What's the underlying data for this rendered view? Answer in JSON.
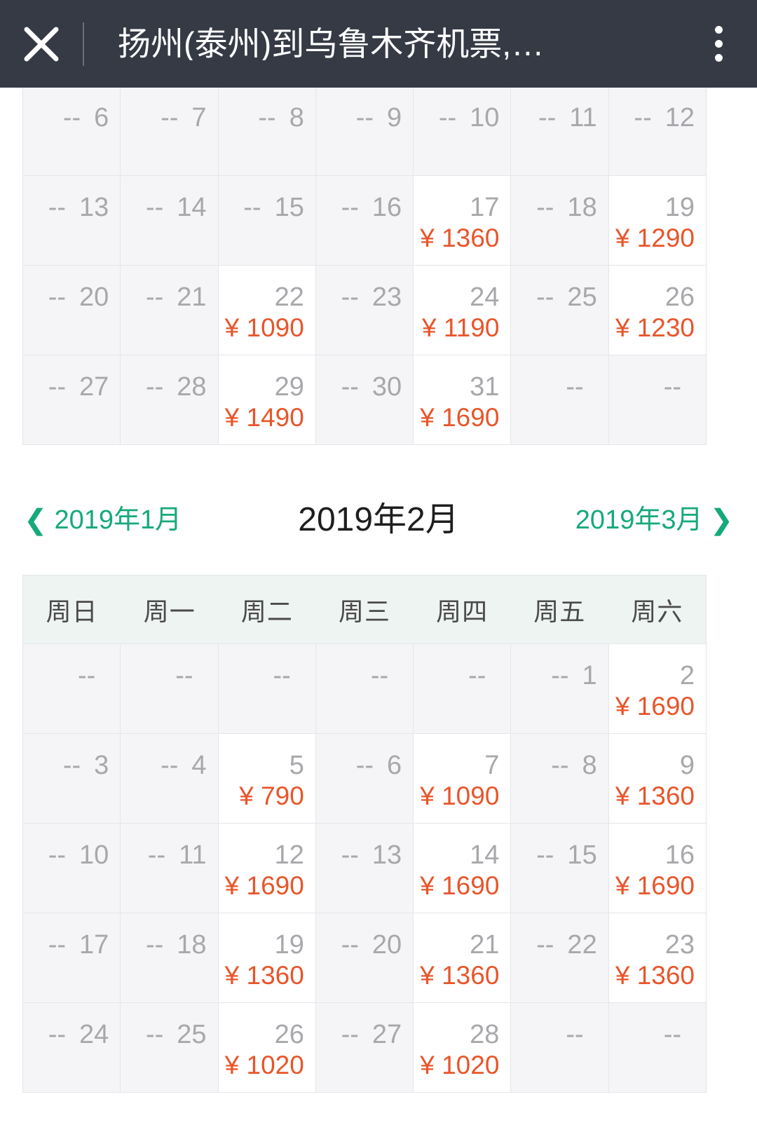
{
  "header": {
    "close_icon": "close-icon",
    "title": "扬州(泰州)到乌鲁木齐机票,…",
    "menu_icon": "more-vertical-icon",
    "background_color": "#353a45"
  },
  "colors": {
    "price": "#e8552a",
    "accent_green": "#16a97b",
    "disabled_cell": "#f5f5f7",
    "enabled_cell": "#ffffff",
    "weekday_header": "#eef4f2"
  },
  "weekdays": [
    "周日",
    "周一",
    "周二",
    "周三",
    "周四",
    "周五",
    "周六"
  ],
  "month_nav": {
    "prev_chevron": "chevron-left-icon",
    "prev_label": "2019年1月",
    "current_label": "2019年2月",
    "next_label": "2019年3月",
    "next_chevron": "chevron-right-icon"
  },
  "calendar_january": {
    "month_label": "2019年1月",
    "rows": [
      [
        {
          "day": "6",
          "dash": "--",
          "price": "",
          "enabled": false
        },
        {
          "day": "7",
          "dash": "--",
          "price": "",
          "enabled": false
        },
        {
          "day": "8",
          "dash": "--",
          "price": "",
          "enabled": false
        },
        {
          "day": "9",
          "dash": "--",
          "price": "",
          "enabled": false
        },
        {
          "day": "10",
          "dash": "--",
          "price": "",
          "enabled": false
        },
        {
          "day": "11",
          "dash": "--",
          "price": "",
          "enabled": false
        },
        {
          "day": "12",
          "dash": "--",
          "price": "",
          "enabled": false
        }
      ],
      [
        {
          "day": "13",
          "dash": "--",
          "price": "",
          "enabled": false
        },
        {
          "day": "14",
          "dash": "--",
          "price": "",
          "enabled": false
        },
        {
          "day": "15",
          "dash": "--",
          "price": "",
          "enabled": false
        },
        {
          "day": "16",
          "dash": "--",
          "price": "",
          "enabled": false
        },
        {
          "day": "17",
          "dash": "",
          "price": "¥ 1360",
          "enabled": true
        },
        {
          "day": "18",
          "dash": "--",
          "price": "",
          "enabled": false
        },
        {
          "day": "19",
          "dash": "",
          "price": "¥ 1290",
          "enabled": true
        }
      ],
      [
        {
          "day": "20",
          "dash": "--",
          "price": "",
          "enabled": false
        },
        {
          "day": "21",
          "dash": "--",
          "price": "",
          "enabled": false
        },
        {
          "day": "22",
          "dash": "",
          "price": "¥ 1090",
          "enabled": true
        },
        {
          "day": "23",
          "dash": "--",
          "price": "",
          "enabled": false
        },
        {
          "day": "24",
          "dash": "",
          "price": "¥ 1190",
          "enabled": true
        },
        {
          "day": "25",
          "dash": "--",
          "price": "",
          "enabled": false
        },
        {
          "day": "26",
          "dash": "",
          "price": "¥ 1230",
          "enabled": true
        }
      ],
      [
        {
          "day": "27",
          "dash": "--",
          "price": "",
          "enabled": false
        },
        {
          "day": "28",
          "dash": "--",
          "price": "",
          "enabled": false
        },
        {
          "day": "29",
          "dash": "",
          "price": "¥ 1490",
          "enabled": true
        },
        {
          "day": "30",
          "dash": "--",
          "price": "",
          "enabled": false
        },
        {
          "day": "31",
          "dash": "",
          "price": "¥ 1690",
          "enabled": true
        },
        {
          "day": "",
          "dash": "--",
          "price": "",
          "enabled": false
        },
        {
          "day": "",
          "dash": "--",
          "price": "",
          "enabled": false
        }
      ]
    ]
  },
  "calendar_february": {
    "month_label": "2019年2月",
    "rows": [
      [
        {
          "day": "",
          "dash": "--",
          "price": "",
          "enabled": false
        },
        {
          "day": "",
          "dash": "--",
          "price": "",
          "enabled": false
        },
        {
          "day": "",
          "dash": "--",
          "price": "",
          "enabled": false
        },
        {
          "day": "",
          "dash": "--",
          "price": "",
          "enabled": false
        },
        {
          "day": "",
          "dash": "--",
          "price": "",
          "enabled": false
        },
        {
          "day": "1",
          "dash": "--",
          "price": "",
          "enabled": false
        },
        {
          "day": "2",
          "dash": "",
          "price": "¥ 1690",
          "enabled": true
        }
      ],
      [
        {
          "day": "3",
          "dash": "--",
          "price": "",
          "enabled": false
        },
        {
          "day": "4",
          "dash": "--",
          "price": "",
          "enabled": false
        },
        {
          "day": "5",
          "dash": "",
          "price": "¥ 790",
          "enabled": true
        },
        {
          "day": "6",
          "dash": "--",
          "price": "",
          "enabled": false
        },
        {
          "day": "7",
          "dash": "",
          "price": "¥ 1090",
          "enabled": true
        },
        {
          "day": "8",
          "dash": "--",
          "price": "",
          "enabled": false
        },
        {
          "day": "9",
          "dash": "",
          "price": "¥ 1360",
          "enabled": true
        }
      ],
      [
        {
          "day": "10",
          "dash": "--",
          "price": "",
          "enabled": false
        },
        {
          "day": "11",
          "dash": "--",
          "price": "",
          "enabled": false
        },
        {
          "day": "12",
          "dash": "",
          "price": "¥ 1690",
          "enabled": true
        },
        {
          "day": "13",
          "dash": "--",
          "price": "",
          "enabled": false
        },
        {
          "day": "14",
          "dash": "",
          "price": "¥ 1690",
          "enabled": true
        },
        {
          "day": "15",
          "dash": "--",
          "price": "",
          "enabled": false
        },
        {
          "day": "16",
          "dash": "",
          "price": "¥ 1690",
          "enabled": true
        }
      ],
      [
        {
          "day": "17",
          "dash": "--",
          "price": "",
          "enabled": false
        },
        {
          "day": "18",
          "dash": "--",
          "price": "",
          "enabled": false
        },
        {
          "day": "19",
          "dash": "",
          "price": "¥ 1360",
          "enabled": true
        },
        {
          "day": "20",
          "dash": "--",
          "price": "",
          "enabled": false
        },
        {
          "day": "21",
          "dash": "",
          "price": "¥ 1360",
          "enabled": true
        },
        {
          "day": "22",
          "dash": "--",
          "price": "",
          "enabled": false
        },
        {
          "day": "23",
          "dash": "",
          "price": "¥ 1360",
          "enabled": true
        }
      ],
      [
        {
          "day": "24",
          "dash": "--",
          "price": "",
          "enabled": false
        },
        {
          "day": "25",
          "dash": "--",
          "price": "",
          "enabled": false
        },
        {
          "day": "26",
          "dash": "",
          "price": "¥ 1020",
          "enabled": true
        },
        {
          "day": "27",
          "dash": "--",
          "price": "",
          "enabled": false
        },
        {
          "day": "28",
          "dash": "",
          "price": "¥ 1020",
          "enabled": true
        },
        {
          "day": "",
          "dash": "--",
          "price": "",
          "enabled": false
        },
        {
          "day": "",
          "dash": "--",
          "price": "",
          "enabled": false
        }
      ]
    ]
  }
}
